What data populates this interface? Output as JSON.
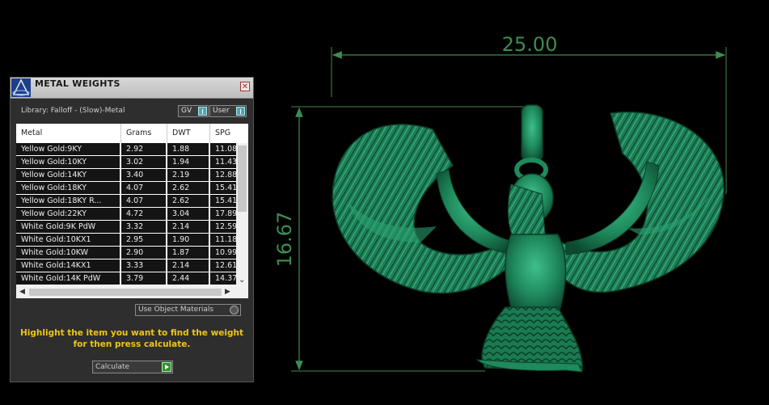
{
  "viewport": {
    "width_dimension": "25.00",
    "height_dimension": "16.67",
    "model_color": "#1f8a5c",
    "dimension_color": "#3e8c51"
  },
  "panel": {
    "title": "METAL WEIGHTS",
    "close_glyph": "✕",
    "library_label": "Library: Falloff - (Slow)-Metal",
    "toggle_gv": "GV",
    "toggle_user": "User",
    "columns": [
      "Metal",
      "Grams",
      "DWT",
      "SPG"
    ],
    "rows": [
      {
        "metal": "Yellow Gold:9KY",
        "grams": "2.92",
        "dwt": "1.88",
        "spg": "11.08"
      },
      {
        "metal": "Yellow Gold:10KY",
        "grams": "3.02",
        "dwt": "1.94",
        "spg": "11.43"
      },
      {
        "metal": "Yellow Gold:14KY",
        "grams": "3.40",
        "dwt": "2.19",
        "spg": "12.88"
      },
      {
        "metal": "Yellow Gold:18KY",
        "grams": "4.07",
        "dwt": "2.62",
        "spg": "15.41"
      },
      {
        "metal": "Yellow Gold:18KY R...",
        "grams": "4.07",
        "dwt": "2.62",
        "spg": "15.41"
      },
      {
        "metal": "Yellow Gold:22KY",
        "grams": "4.72",
        "dwt": "3.04",
        "spg": "17.89"
      },
      {
        "metal": "White Gold:9K PdW",
        "grams": "3.32",
        "dwt": "2.14",
        "spg": "12.59"
      },
      {
        "metal": "White Gold:10KX1",
        "grams": "2.95",
        "dwt": "1.90",
        "spg": "11.18"
      },
      {
        "metal": "White Gold:10KW",
        "grams": "2.90",
        "dwt": "1.87",
        "spg": "10.99"
      },
      {
        "metal": "White Gold:14KX1",
        "grams": "3.33",
        "dwt": "2.14",
        "spg": "12.61"
      },
      {
        "metal": "White Gold:14K PdW",
        "grams": "3.79",
        "dwt": "2.44",
        "spg": "14.37"
      }
    ],
    "use_object_materials": "Use Object Materials",
    "help_text": "Highlight the item you want to find the weight for then press calculate.",
    "calculate_label": "Calculate",
    "accent_color": "#f0c419"
  }
}
